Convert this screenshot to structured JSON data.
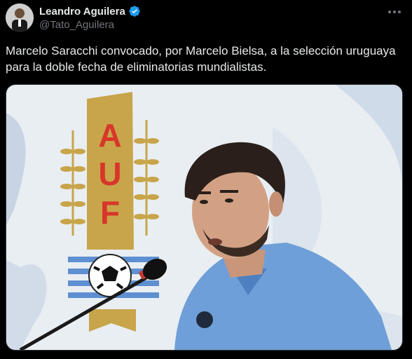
{
  "author": {
    "display_name": "Leandro Aguilera",
    "handle": "@Tato_Aguilera",
    "verified_color": "#1d9bf0"
  },
  "tweet": {
    "text": "Marcelo Saracchi convocado, por Marcelo Bielsa, a la selección uruguaya para la doble fecha de eliminatorias mundialistas."
  },
  "media": {
    "logo_letters": [
      "A",
      "U",
      "F"
    ],
    "backdrop_color": "#e9eef3",
    "shield_color": "#c8a54a",
    "logo_text_color": "#d8362a",
    "shirt_color": "#6f9fd8"
  },
  "icons": {
    "more": "more-horizontal-icon",
    "verified": "verified-badge-icon"
  }
}
